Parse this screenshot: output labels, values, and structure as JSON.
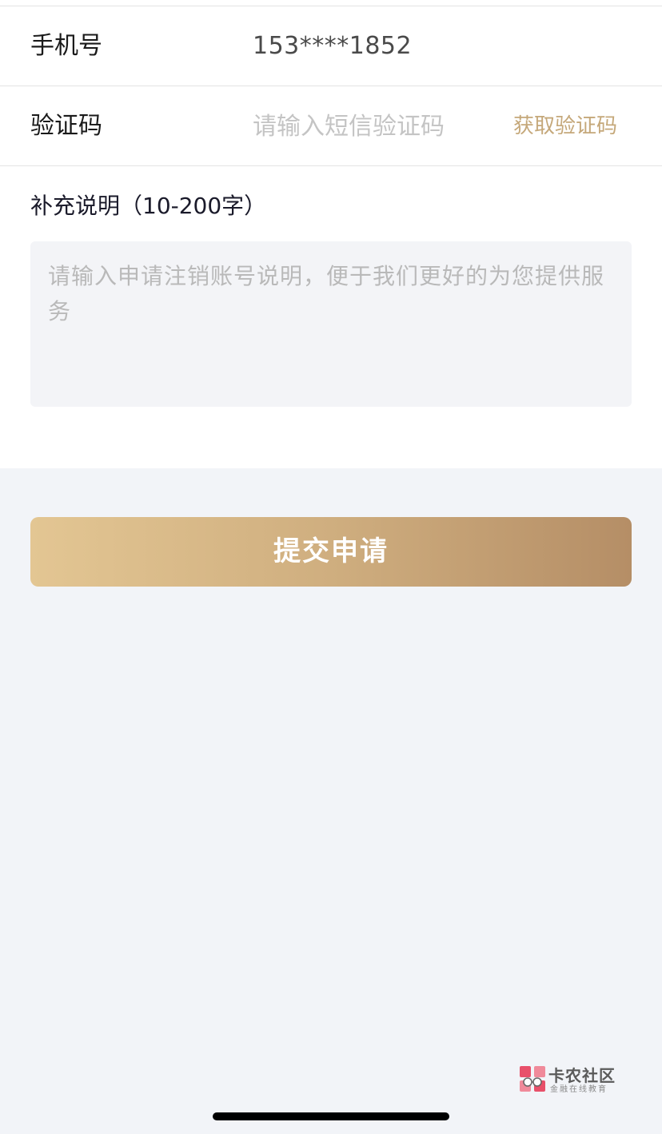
{
  "form": {
    "phone": {
      "label": "手机号",
      "value": "153****1852"
    },
    "code": {
      "label": "验证码",
      "placeholder": "请输入短信验证码",
      "get_code_label": "获取验证码"
    },
    "note": {
      "label": "补充说明（10-200字）",
      "placeholder": "请输入申请注销账号说明，便于我们更好的为您提供服务"
    }
  },
  "submit": {
    "label": "提交申请"
  },
  "watermark": {
    "title": "卡农社区",
    "subtitle": "金融在线教育"
  },
  "colors": {
    "accent": "#c5a87a",
    "button_start": "#e3c693",
    "button_end": "#b58e66",
    "background": "#f2f4f8"
  }
}
